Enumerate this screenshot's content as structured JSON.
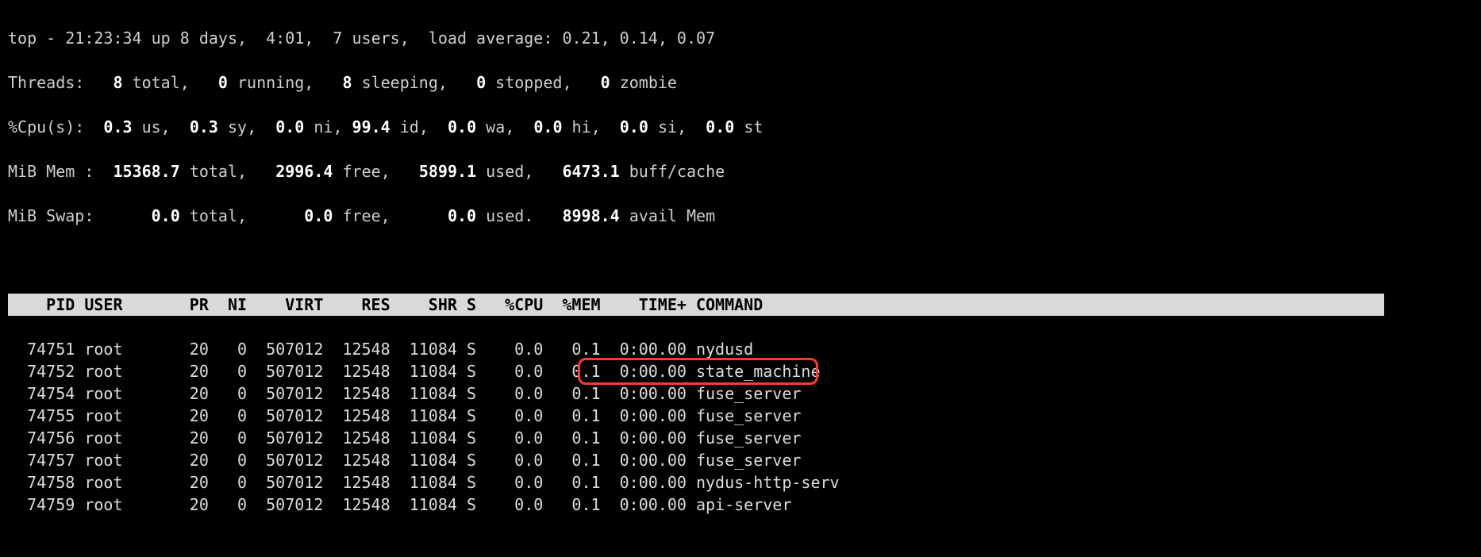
{
  "summary": {
    "prefix": "top - ",
    "time": "21:23:34",
    "up_label": " up ",
    "uptime": "8 days,  4:01",
    "users": "7 users",
    "load_label": "load average:",
    "load": "0.21, 0.14, 0.07"
  },
  "threads": {
    "label": "Threads:",
    "total": "8",
    "total_lbl": "total,",
    "running": "0",
    "running_lbl": "running,",
    "sleeping": "8",
    "sleeping_lbl": "sleeping,",
    "stopped": "0",
    "stopped_lbl": "stopped,",
    "zombie": "0",
    "zombie_lbl": "zombie"
  },
  "cpu": {
    "label": "%Cpu(s):",
    "us": "0.3",
    "us_lbl": "us,",
    "sy": "0.3",
    "sy_lbl": "sy,",
    "ni": "0.0",
    "ni_lbl": "ni,",
    "id": "99.4",
    "id_lbl": "id,",
    "wa": "0.0",
    "wa_lbl": "wa,",
    "hi": "0.0",
    "hi_lbl": "hi,",
    "si": "0.0",
    "si_lbl": "si,",
    "st": "0.0",
    "st_lbl": "st"
  },
  "mem": {
    "label": "MiB Mem :",
    "total": "15368.7",
    "total_lbl": "total,",
    "free": "2996.4",
    "free_lbl": "free,",
    "used": "5899.1",
    "used_lbl": "used,",
    "buff": "6473.1",
    "buff_lbl": "buff/cache"
  },
  "swap": {
    "label": "MiB Swap:",
    "total": "0.0",
    "total_lbl": "total,",
    "free": "0.0",
    "free_lbl": "free,",
    "used": "0.0",
    "used_lbl": "used.",
    "avail": "8998.4",
    "avail_lbl": "avail Mem"
  },
  "columns": {
    "pid": "PID",
    "user": "USER",
    "pr": "PR",
    "ni": "NI",
    "virt": "VIRT",
    "res": "RES",
    "shr": "SHR",
    "s": "S",
    "cpu": "%CPU",
    "mem": "%MEM",
    "time": "TIME+",
    "cmd": "COMMAND"
  },
  "rows": [
    {
      "pid": "74751",
      "user": "root",
      "pr": "20",
      "ni": "0",
      "virt": "507012",
      "res": "12548",
      "shr": "11084",
      "s": "S",
      "cpu": "0.0",
      "mem": "0.1",
      "time": "0:00.00",
      "cmd": "nydusd",
      "hl": false
    },
    {
      "pid": "74752",
      "user": "root",
      "pr": "20",
      "ni": "0",
      "virt": "507012",
      "res": "12548",
      "shr": "11084",
      "s": "S",
      "cpu": "0.0",
      "mem": "0.1",
      "time": "0:00.00",
      "cmd": "state_machine",
      "hl": true
    },
    {
      "pid": "74754",
      "user": "root",
      "pr": "20",
      "ni": "0",
      "virt": "507012",
      "res": "12548",
      "shr": "11084",
      "s": "S",
      "cpu": "0.0",
      "mem": "0.1",
      "time": "0:00.00",
      "cmd": "fuse_server",
      "hl": false
    },
    {
      "pid": "74755",
      "user": "root",
      "pr": "20",
      "ni": "0",
      "virt": "507012",
      "res": "12548",
      "shr": "11084",
      "s": "S",
      "cpu": "0.0",
      "mem": "0.1",
      "time": "0:00.00",
      "cmd": "fuse_server",
      "hl": false
    },
    {
      "pid": "74756",
      "user": "root",
      "pr": "20",
      "ni": "0",
      "virt": "507012",
      "res": "12548",
      "shr": "11084",
      "s": "S",
      "cpu": "0.0",
      "mem": "0.1",
      "time": "0:00.00",
      "cmd": "fuse_server",
      "hl": false
    },
    {
      "pid": "74757",
      "user": "root",
      "pr": "20",
      "ni": "0",
      "virt": "507012",
      "res": "12548",
      "shr": "11084",
      "s": "S",
      "cpu": "0.0",
      "mem": "0.1",
      "time": "0:00.00",
      "cmd": "fuse_server",
      "hl": false
    },
    {
      "pid": "74758",
      "user": "root",
      "pr": "20",
      "ni": "0",
      "virt": "507012",
      "res": "12548",
      "shr": "11084",
      "s": "S",
      "cpu": "0.0",
      "mem": "0.1",
      "time": "0:00.00",
      "cmd": "nydus-http-serv",
      "hl": false
    },
    {
      "pid": "74759",
      "user": "root",
      "pr": "20",
      "ni": "0",
      "virt": "507012",
      "res": "12548",
      "shr": "11084",
      "s": "S",
      "cpu": "0.0",
      "mem": "0.1",
      "time": "0:00.00",
      "cmd": "api-server",
      "hl": false
    }
  ],
  "highlight": {
    "left_ch": 60,
    "width_ch": 24
  }
}
